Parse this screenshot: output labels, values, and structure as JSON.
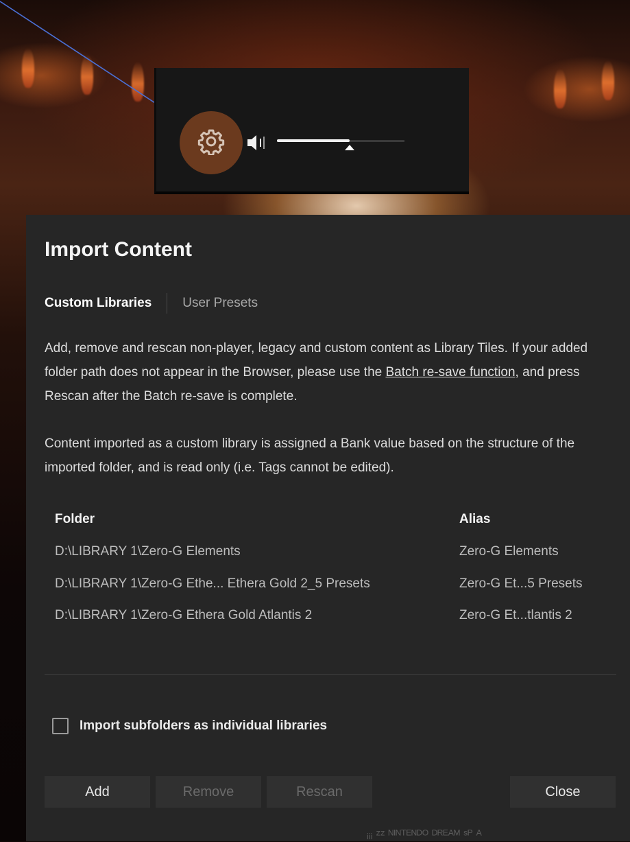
{
  "toolbar": {
    "settings_icon": "gear-icon",
    "volume_icon": "speaker-icon",
    "volume_level_fraction": 0.57
  },
  "dialog": {
    "title": "Import Content",
    "tabs": [
      {
        "label": "Custom Libraries",
        "active": true
      },
      {
        "label": "User Presets",
        "active": false
      }
    ],
    "description": {
      "text_before_link": "Add, remove and rescan non-player, legacy and custom content as Library Tiles. If your added folder path does not appear in the Browser, please use the ",
      "link_text": "Batch re-save function",
      "text_after_link": ", and press Rescan after the Batch re-save is complete."
    },
    "note": "Content imported as a custom library is assigned a Bank value based on the structure of the imported folder, and is read only (i.e. Tags cannot be edited).",
    "table": {
      "headers": {
        "folder": "Folder",
        "alias": "Alias"
      },
      "rows": [
        {
          "folder": "D:\\LIBRARY 1\\Zero-G Elements",
          "alias": "Zero-G Elements"
        },
        {
          "folder": "D:\\LIBRARY 1\\Zero-G Ethe... Ethera Gold 2_5 Presets",
          "alias": "Zero-G Et...5 Presets"
        },
        {
          "folder": "D:\\LIBRARY 1\\Zero-G Ethera Gold Atlantis 2",
          "alias": "Zero-G Et...tlantis 2"
        }
      ]
    },
    "import_subfolders": {
      "label": "Import subfolders as individual libraries",
      "checked": false
    },
    "buttons": {
      "add": "Add",
      "remove": "Remove",
      "rescan": "Rescan",
      "close": "Close"
    }
  },
  "background_text": "ᵢᵢᵢ ᶻᶻ ᴺᴵᴺᵀᴱᴺᴰᴼ ᴰᴿᴱᴬᴹ ˢᴾ ᴬ",
  "colors": {
    "accent_highlight": "#6b3a1e",
    "dialog_bg": "#262626",
    "button_bg": "#303030"
  }
}
